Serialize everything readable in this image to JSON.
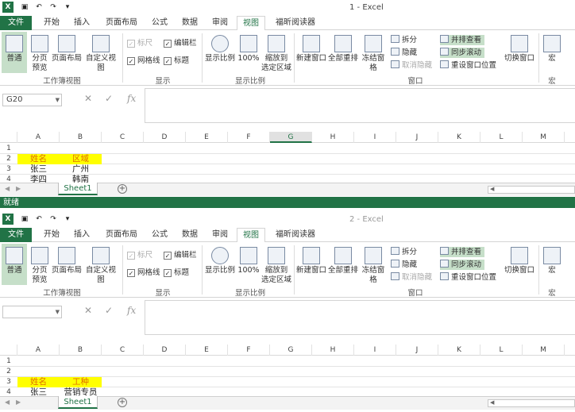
{
  "windows": [
    {
      "title": "1 - Excel",
      "namebox": "G20",
      "col_selected": "G",
      "rows": [
        {
          "num": "1",
          "a": "",
          "b": "",
          "hl": false
        },
        {
          "num": "2",
          "a": "姓名",
          "b": "区域",
          "hl": true
        },
        {
          "num": "3",
          "a": "张三",
          "b": "广州",
          "hl": false
        },
        {
          "num": "4",
          "a": "李四",
          "b": "韩南",
          "hl": false
        }
      ],
      "status": "就绪"
    },
    {
      "title": "2 - Excel",
      "namebox": "",
      "col_selected": "",
      "rows": [
        {
          "num": "1",
          "a": "",
          "b": "",
          "hl": false
        },
        {
          "num": "2",
          "a": "",
          "b": "",
          "hl": false
        },
        {
          "num": "3",
          "a": "姓名",
          "b": "工种",
          "hl": true
        },
        {
          "num": "4",
          "a": "张三",
          "b": "营销专员",
          "hl": false
        }
      ],
      "status": ""
    }
  ],
  "tabs": [
    "文件",
    "开始",
    "插入",
    "页面布局",
    "公式",
    "数据",
    "审阅",
    "视图",
    "福昕阅读器"
  ],
  "active_tab": "视图",
  "ribbon": {
    "normal": "普通",
    "pagebreak": "分页\n预览",
    "pagelayout": "页面布局",
    "customview": "自定义视图",
    "group_workbook_views": "工作簿视图",
    "ruler": "标尺",
    "formula_bar": "编辑栏",
    "gridlines": "网格线",
    "headings": "标题",
    "group_show": "显示",
    "zoom": "显示比例",
    "zoom100": "100%",
    "zoom_selection": "缩放到\n选定区域",
    "group_zoom": "显示比例",
    "new_window": "新建窗口",
    "arrange_all": "全部重排",
    "freeze": "冻结窗格",
    "split": "拆分",
    "hide": "隐藏",
    "unhide": "取消隐藏",
    "side_by_side": "并排查看",
    "sync_scroll": "同步滚动",
    "reset_position": "重设窗口位置",
    "switch_windows": "切换窗口",
    "group_window": "窗口",
    "macros": "宏",
    "group_macros": "宏"
  },
  "columns": [
    "A",
    "B",
    "C",
    "D",
    "E",
    "F",
    "G",
    "H",
    "I",
    "J",
    "K",
    "L",
    "M"
  ],
  "sheet_tab": "Sheet1",
  "fx": "fx",
  "accent": "#217346",
  "highlight": "#ffff00"
}
